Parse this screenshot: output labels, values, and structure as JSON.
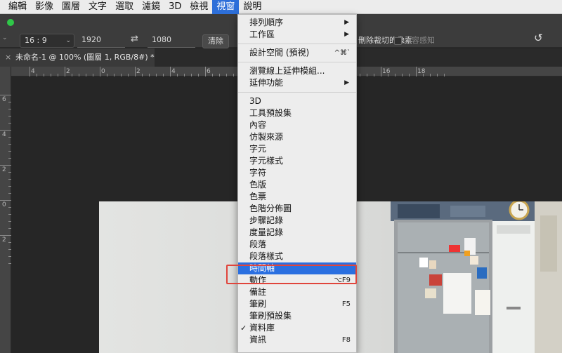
{
  "menubar": {
    "items": [
      "編輯",
      "影像",
      "圖層",
      "文字",
      "選取",
      "濾鏡",
      "3D",
      "檢視",
      "視窗",
      "說明"
    ],
    "active_index": 8
  },
  "options": {
    "ratio": "16 : 9",
    "width": "1920",
    "height": "1080",
    "clear_label": "清除",
    "delete_cropped_label": "刪除裁切的像素",
    "content_aware_label": "內容感知"
  },
  "tab": {
    "title": "未命名-1 @ 100% (圖層 1, RGB/8#) *",
    "close": "×"
  },
  "rulers": {
    "h_labels": [
      "4",
      "2",
      "0",
      "2",
      "4",
      "6",
      "8",
      "10",
      "12",
      "14",
      "16",
      "18"
    ],
    "v_labels": [
      "6",
      "4",
      "2",
      "0",
      "2"
    ]
  },
  "menu": {
    "items": [
      {
        "label": "排列順序",
        "submenu": true
      },
      {
        "label": "工作區",
        "submenu": true
      },
      {
        "sep": true
      },
      {
        "label": "設計空間 (預視)",
        "shortcut": "^⌘`"
      },
      {
        "sep": true
      },
      {
        "label": "瀏覽線上延伸模組..."
      },
      {
        "label": "延伸功能",
        "submenu": true
      },
      {
        "sep": true
      },
      {
        "label": "3D"
      },
      {
        "label": "工具預設集"
      },
      {
        "label": "內容"
      },
      {
        "label": "仿製來源"
      },
      {
        "label": "字元"
      },
      {
        "label": "字元樣式"
      },
      {
        "label": "字符"
      },
      {
        "label": "色版"
      },
      {
        "label": "色票"
      },
      {
        "label": "色階分佈圖"
      },
      {
        "label": "步驟記錄"
      },
      {
        "label": "度量記錄"
      },
      {
        "label": "段落"
      },
      {
        "label": "段落樣式"
      },
      {
        "label": "時間軸",
        "highlighted": true
      },
      {
        "label": "動作",
        "shortcut": "⌥F9"
      },
      {
        "label": "備註"
      },
      {
        "label": "筆刷",
        "shortcut": "F5"
      },
      {
        "label": "筆刷預設集"
      },
      {
        "label": "資料庫",
        "checked": true
      },
      {
        "label": "資訊",
        "shortcut": "F8"
      }
    ]
  },
  "colors": {
    "menu_highlight": "#2a6fe0",
    "annotation_box": "#e0453c"
  }
}
